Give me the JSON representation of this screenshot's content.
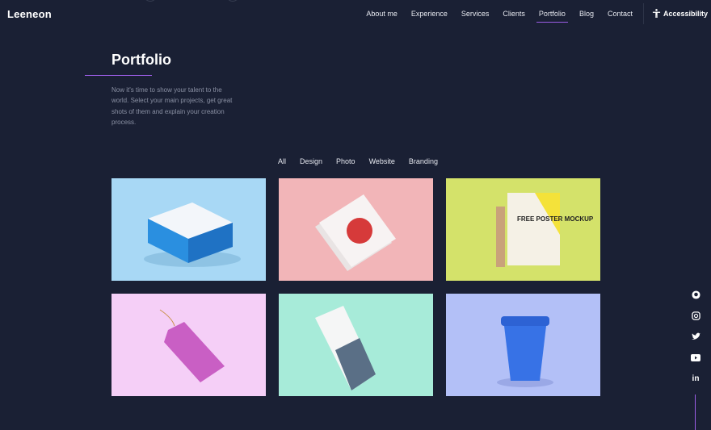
{
  "brand": "Leeneon",
  "nav": [
    "About me",
    "Experience",
    "Services",
    "Clients",
    "Portfolio",
    "Blog",
    "Contact"
  ],
  "nav_active": "Portfolio",
  "accessibility": "Accessibility",
  "section": {
    "title": "Portfolio",
    "description": "Now it's time to show your talent to the world. Select your main projects, get great shots of them and explain your creation process."
  },
  "filters": [
    "All",
    "Design",
    "Photo",
    "Website",
    "Branding"
  ],
  "projects": [
    {
      "name": "box-mockup",
      "bg": "#a8d8f5"
    },
    {
      "name": "flyer-mockup",
      "bg": "#f2b5b8"
    },
    {
      "name": "poster-mockup",
      "bg": "#d4e26a",
      "lettering": "FREE POSTER MOCKUP"
    },
    {
      "name": "tag-mockup",
      "bg": "#f5cff7"
    },
    {
      "name": "brochure-mockup",
      "bg": "#a7ebd9"
    },
    {
      "name": "cup-mockup",
      "bg": "#b3c0f7"
    }
  ],
  "social": [
    "github-icon",
    "instagram-icon",
    "twitter-icon",
    "youtube-icon",
    "linkedin-icon"
  ],
  "colors": {
    "background": "#1a2034",
    "accent": "#9b5de5"
  }
}
